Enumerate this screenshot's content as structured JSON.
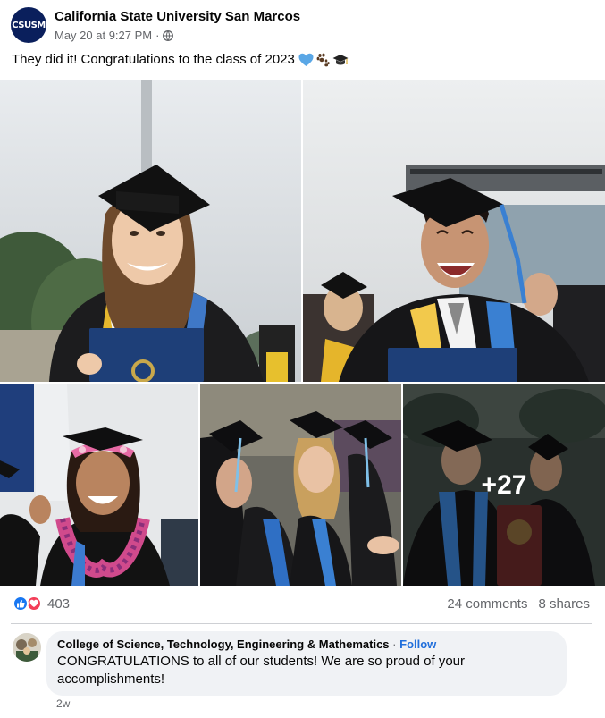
{
  "post": {
    "page_name": "California State University San Marcos",
    "avatar_text": "CSUSM",
    "timestamp": "May 20 at 9:27 PM",
    "meta_separator": "·",
    "audience_icon": "globe-icon",
    "caption": "They did it! Congratulations to the class of 2023",
    "caption_emoji": [
      "blue-heart-icon",
      "paw-prints-icon",
      "graduation-cap-icon"
    ]
  },
  "photos": {
    "count": 5,
    "more_count": "+27"
  },
  "stats": {
    "reaction_icons": [
      "like-icon",
      "love-icon"
    ],
    "reaction_count": "403",
    "comments": "24 comments",
    "shares": "8 shares"
  },
  "comment": {
    "author": "College of Science, Technology, Engineering & Mathematics",
    "separator": "·",
    "follow_label": "Follow",
    "text": "CONGRATULATIONS to all of our students! We are so proud of your accomplishments!",
    "time": "2w"
  },
  "colors": {
    "csusm_blue": "#0a1f5c",
    "like_blue": "#1877f2",
    "love_red": "#f33e58",
    "link_blue": "#216fdb",
    "meta_gray": "#65676b"
  }
}
